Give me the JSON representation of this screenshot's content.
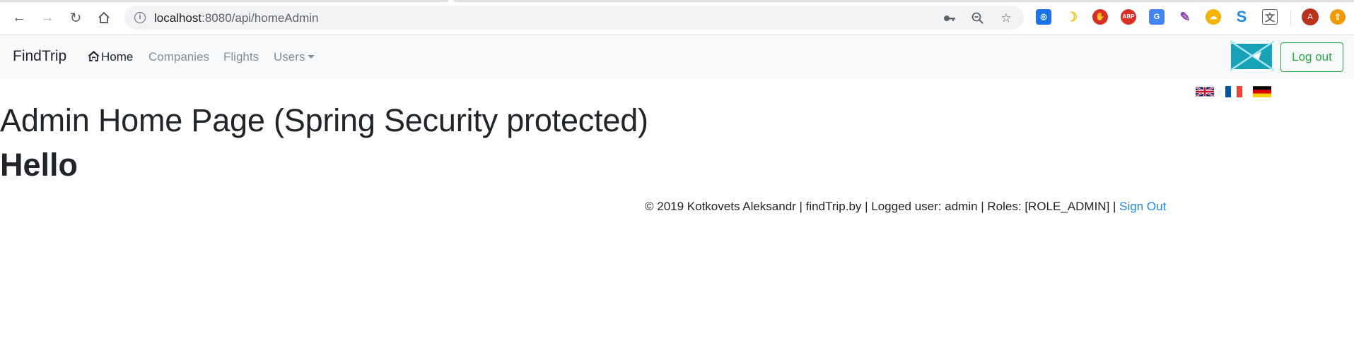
{
  "browser": {
    "url_host": "localhost",
    "url_path": ":8080/api/homeAdmin",
    "back_icon": "arrow-left-icon",
    "forward_icon": "arrow-right-icon",
    "reload_icon": "reload-icon",
    "home_icon": "home-icon",
    "extensions": [
      {
        "name": "target-ext",
        "glyph": "◎",
        "color": "#1a73e8"
      },
      {
        "name": "moon-ext",
        "glyph": "☽",
        "color": "#f2c200"
      },
      {
        "name": "stop-hand-ext",
        "glyph": "✋",
        "color": "#d93025"
      },
      {
        "name": "adblock-ext",
        "glyph": "ABP",
        "color": "#d93025"
      },
      {
        "name": "translate-ext",
        "glyph": "G",
        "color": "#4285f4"
      },
      {
        "name": "pen-ext",
        "glyph": "✎",
        "color": "#8e44ad"
      },
      {
        "name": "cloud-ext",
        "glyph": "☁",
        "color": "#f4b400"
      },
      {
        "name": "s-ext",
        "glyph": "S",
        "color": "#1e88e5"
      },
      {
        "name": "translate2-ext",
        "glyph": "文",
        "color": "#5f6368"
      }
    ],
    "profile_letter": "A",
    "profile_color": "#b8321e",
    "update_color": "#f29900"
  },
  "navbar": {
    "brand": "FindTrip",
    "home": "Home",
    "companies": "Companies",
    "flights": "Flights",
    "users": "Users",
    "logout": "Log out"
  },
  "colors": {
    "navbar_bg": "#f8f9fa",
    "success": "#28a745",
    "link": "#1e88e5",
    "broken_image": "#17a2b8"
  },
  "flags": [
    "uk-flag",
    "france-flag",
    "germany-flag"
  ],
  "main": {
    "title": "Admin Home Page (Spring Security protected)",
    "greeting": "Hello"
  },
  "footer": {
    "text": "© 2019 Kotkovets Aleksandr | findTrip.by | Logged user: admin | Roles: [ROLE_ADMIN] | ",
    "sign_out": "Sign Out"
  }
}
